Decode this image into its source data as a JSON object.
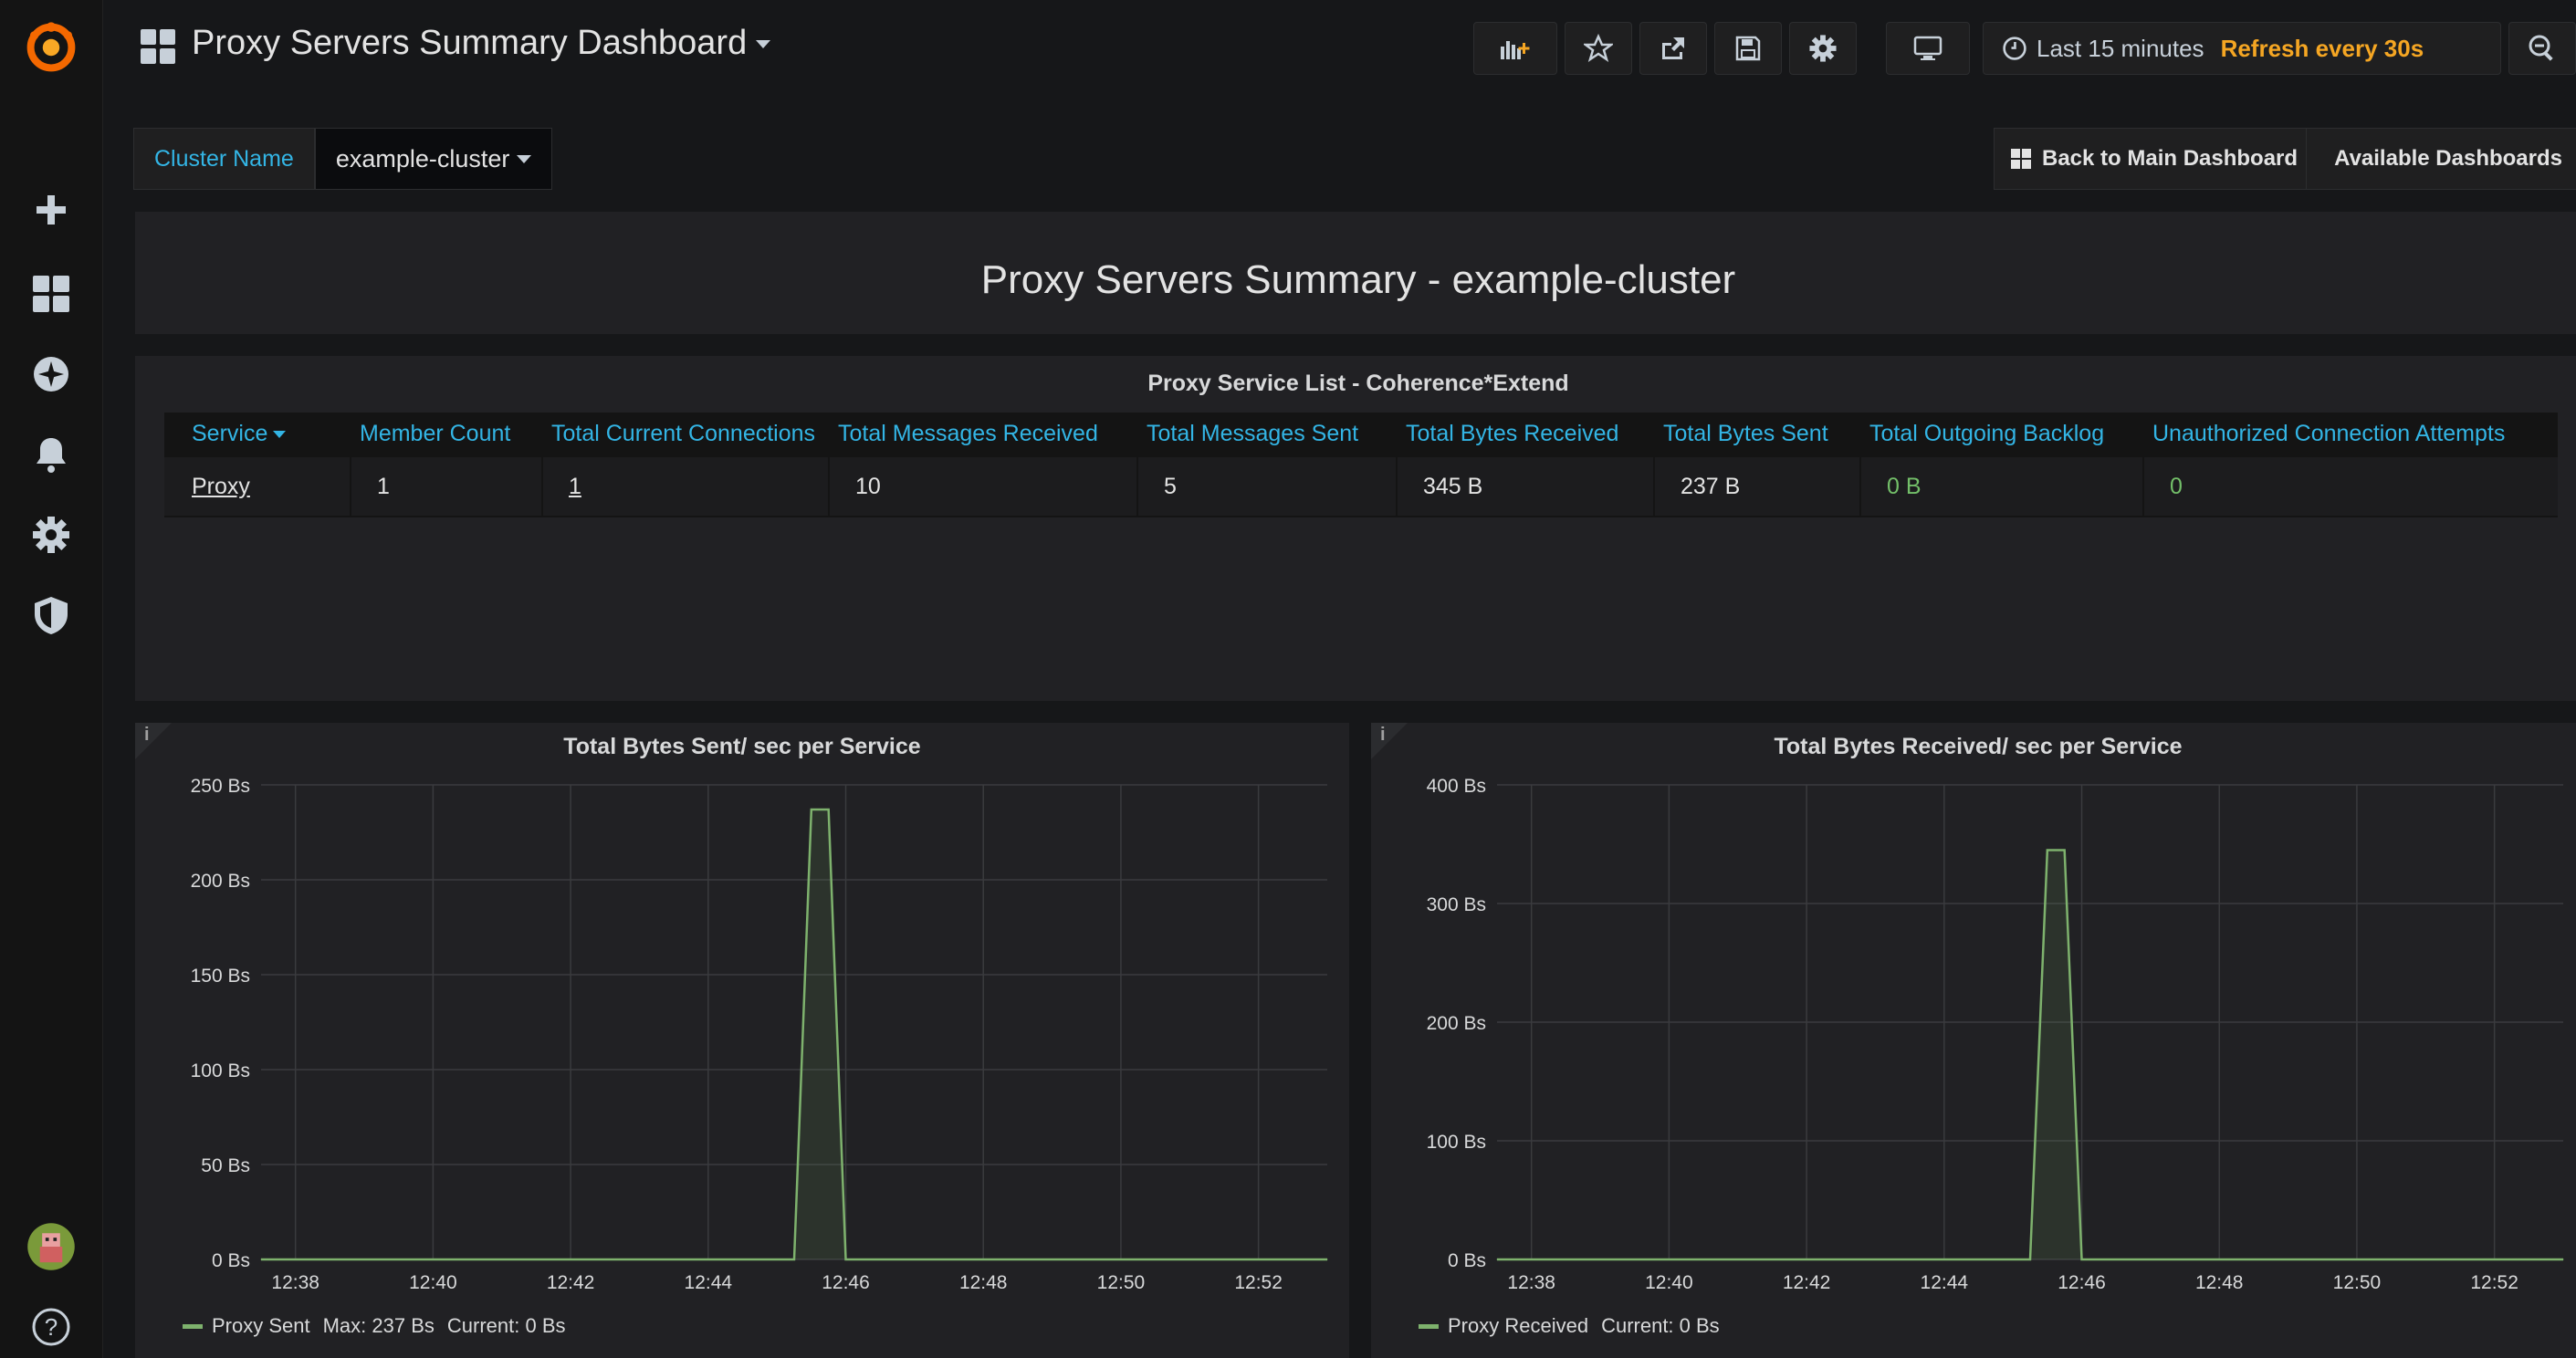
{
  "header": {
    "title": "Proxy Servers Summary Dashboard"
  },
  "timepicker": {
    "range": "Last 15 minutes",
    "refresh": "Refresh every 30s"
  },
  "variables": {
    "label": "Cluster Name",
    "value": "example-cluster"
  },
  "links": {
    "back": "Back to Main Dashboard",
    "available": "Available Dashboards"
  },
  "text_panel": {
    "title": "Proxy Servers Summary - example-cluster"
  },
  "table_panel": {
    "title": "Proxy Service List - Coherence*Extend",
    "columns": [
      "Service",
      "Member Count",
      "Total Current Connections",
      "Total Messages Received",
      "Total Messages Sent",
      "Total Bytes Received",
      "Total Bytes Sent",
      "Total Outgoing Backlog",
      "Unauthorized Connection Attempts"
    ],
    "rows": [
      [
        "Proxy",
        "1",
        "1",
        "10",
        "5",
        "345 B",
        "237 B",
        "0 B",
        "0"
      ]
    ]
  },
  "chart_data": [
    {
      "type": "line",
      "title": "Total Bytes Sent/ sec per Service",
      "x_ticks": [
        "12:38",
        "12:40",
        "12:42",
        "12:44",
        "12:46",
        "12:48",
        "12:50",
        "12:52"
      ],
      "y_ticks": [
        "0 Bs",
        "50 Bs",
        "100 Bs",
        "150 Bs",
        "200 Bs",
        "250 Bs"
      ],
      "ylim": [
        0,
        250
      ],
      "xlim": [
        "12:37:30",
        "12:53"
      ],
      "series": [
        {
          "name": "Proxy Sent",
          "color": "#7eb26d",
          "x": [
            "12:37:30",
            "12:45:15",
            "12:45:30",
            "12:45:45",
            "12:46:00",
            "12:53:00"
          ],
          "values": [
            0,
            0,
            237,
            237,
            0,
            0
          ]
        }
      ],
      "legend": {
        "name": "Proxy Sent",
        "stats": "Max: 237 Bs",
        "current": "Current: 0 Bs"
      }
    },
    {
      "type": "line",
      "title": "Total Bytes Received/ sec per Service",
      "x_ticks": [
        "12:38",
        "12:40",
        "12:42",
        "12:44",
        "12:46",
        "12:48",
        "12:50",
        "12:52"
      ],
      "y_ticks": [
        "0 Bs",
        "100 Bs",
        "200 Bs",
        "300 Bs",
        "400 Bs"
      ],
      "ylim": [
        0,
        400
      ],
      "xlim": [
        "12:37:30",
        "12:53"
      ],
      "series": [
        {
          "name": "Proxy Received",
          "color": "#7eb26d",
          "x": [
            "12:37:30",
            "12:45:15",
            "12:45:30",
            "12:45:45",
            "12:46:00",
            "12:53:00"
          ],
          "values": [
            0,
            0,
            345,
            345,
            0,
            0
          ]
        }
      ],
      "legend": {
        "name": "Proxy Received",
        "current": "Current: 0 Bs"
      }
    }
  ]
}
